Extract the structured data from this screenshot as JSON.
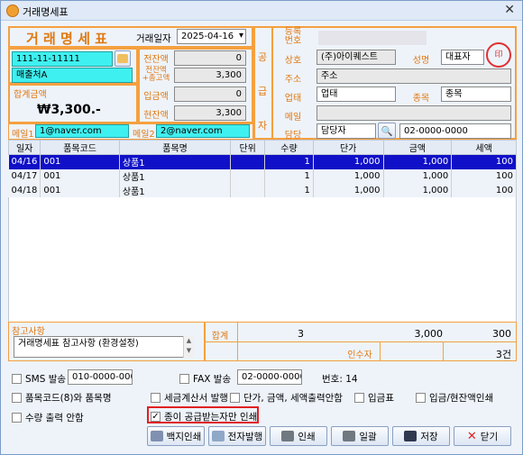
{
  "window": {
    "title": "거래명세표"
  },
  "header": {
    "doc_title": "거 래 명 세 표",
    "date_label": "거래일자",
    "date_value": "2025-04-16"
  },
  "buyer": {
    "biz_no": "111-11-11111",
    "name": "매출처A",
    "total_label": "합계금액",
    "total_value": "₩3,300.-",
    "email1_label": "메일1",
    "email1": "1@naver.com",
    "email2_label": "메일2",
    "email2": "2@naver.com"
  },
  "balances": {
    "prev_label": "전잔액",
    "prev_value": "0",
    "prev_plus_label": "전잔액\n+총고액",
    "prev_plus_value": "3,300",
    "paid_label": "입금액",
    "paid_value": "0",
    "current_label": "현잔액",
    "current_value": "3,300"
  },
  "supplier": {
    "side_label": "공\n급\n자",
    "reg_label": "등록\n번호",
    "company_label": "상호",
    "company_value": "(주)아이퀘스트",
    "rep_label": "성명",
    "rep_value": "대표자",
    "addr_label": "주소",
    "addr_value": "주소",
    "biz_type_label": "업태",
    "biz_type_value": "업태",
    "item_label": "종목",
    "item_value": "종목",
    "mail_label": "메일",
    "mail_value": "",
    "manager_label": "담당",
    "manager_value": "담당자",
    "phone_value": "02-0000-0000"
  },
  "table": {
    "headers": [
      "일자",
      "품목코드",
      "품목명",
      "단위",
      "수량",
      "단가",
      "금액",
      "세액"
    ],
    "rows": [
      [
        "04/16",
        "001",
        "상품1",
        "",
        "1",
        "1,000",
        "1,000",
        "100"
      ],
      [
        "04/17",
        "001",
        "상품1",
        "",
        "1",
        "1,000",
        "1,000",
        "100"
      ],
      [
        "04/18",
        "001",
        "상품1",
        "",
        "1",
        "1,000",
        "1,000",
        "100"
      ]
    ]
  },
  "footer": {
    "memo_label": "참고사항",
    "memo_value": "거래명세표 참고사항 (환경설정)",
    "sum_label": "합계",
    "sum_qty": "3",
    "sum_amount": "3,000",
    "sum_tax": "300",
    "receiver_label": "인수자",
    "count": "3건"
  },
  "options": {
    "sms_label": "SMS 발송",
    "sms_phone": "010-0000-0000",
    "fax_label": "FAX 발송",
    "fax_phone": "02-0000-0000",
    "number_label": "번호: 14",
    "item_code_label": "품목코드(8)와 품목명",
    "tax_invoice_label": "세금계산서 발행",
    "price_print_label": "단가, 금액, 세액출력안함",
    "receipt_label": "입금표",
    "balance_print_label": "입금/현잔액인쇄",
    "qty_label": "수량 출력 안함",
    "paper_label": "종이 공급받는자만 인쇄"
  },
  "buttons": {
    "blank": "백지인쇄",
    "electronic": "전자발행",
    "print": "인쇄",
    "bulk": "일괄",
    "save": "저장",
    "close": "닫기"
  }
}
